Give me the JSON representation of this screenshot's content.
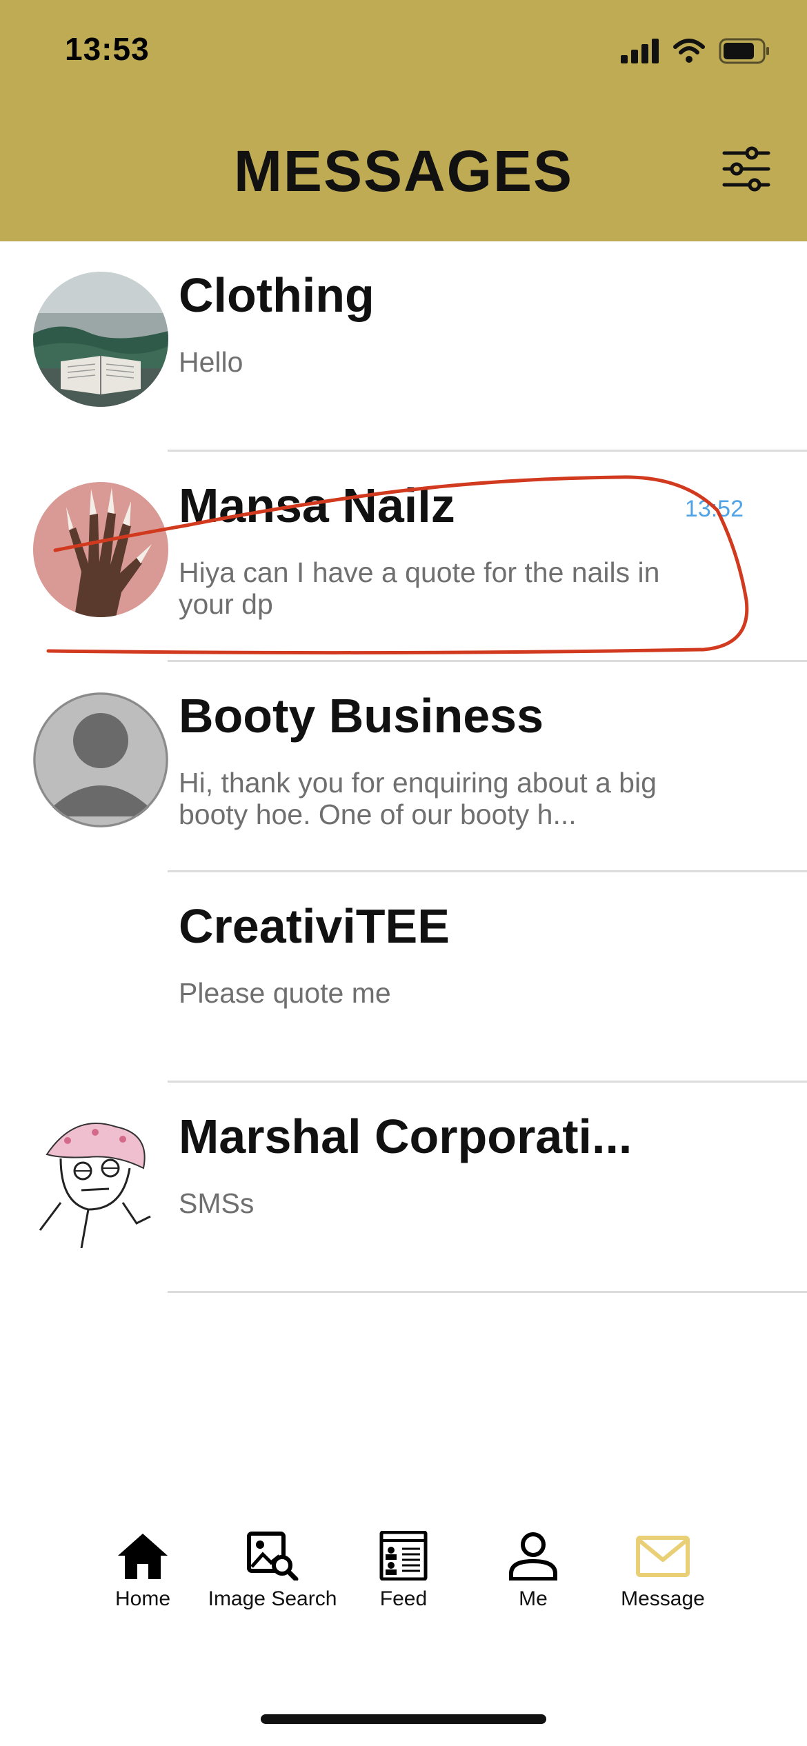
{
  "status_bar": {
    "time": "13:53",
    "icons": [
      "cellular-signal-icon",
      "wifi-icon",
      "battery-icon"
    ]
  },
  "header": {
    "title": "MESSAGES",
    "background": "#bfab54",
    "filter_icon": "sliders-icon"
  },
  "conversations": [
    {
      "name": "Clothing",
      "preview": "Hello",
      "time": "",
      "avatar": "landscape-book-photo"
    },
    {
      "name": "Mansa Nailz",
      "preview": "Hiya can I have a quote for the nails in your dp",
      "time": "13:52",
      "avatar": "hand-nails-photo",
      "annotated": true
    },
    {
      "name": "Booty Business",
      "preview": "Hi, thank you for enquiring about a big booty hoe. One of our booty h...",
      "time": "",
      "avatar": "default-person-avatar"
    },
    {
      "name": "CreativiTEE",
      "preview": "Please quote me",
      "time": "",
      "avatar": "none"
    },
    {
      "name": "Marshal Corporati...",
      "preview": "SMSs",
      "time": "",
      "avatar": "cartoon-drawing"
    }
  ],
  "tabbar": {
    "tabs": [
      {
        "label": "Home",
        "icon": "home-icon"
      },
      {
        "label": "Image Search",
        "icon": "image-search-icon"
      },
      {
        "label": "Feed",
        "icon": "feed-icon"
      },
      {
        "label": "Me",
        "icon": "person-icon"
      },
      {
        "label": "Message",
        "icon": "mail-icon",
        "active": true
      }
    ],
    "active_color": "#e9cf76"
  },
  "annotation_color": "#d23a1f"
}
